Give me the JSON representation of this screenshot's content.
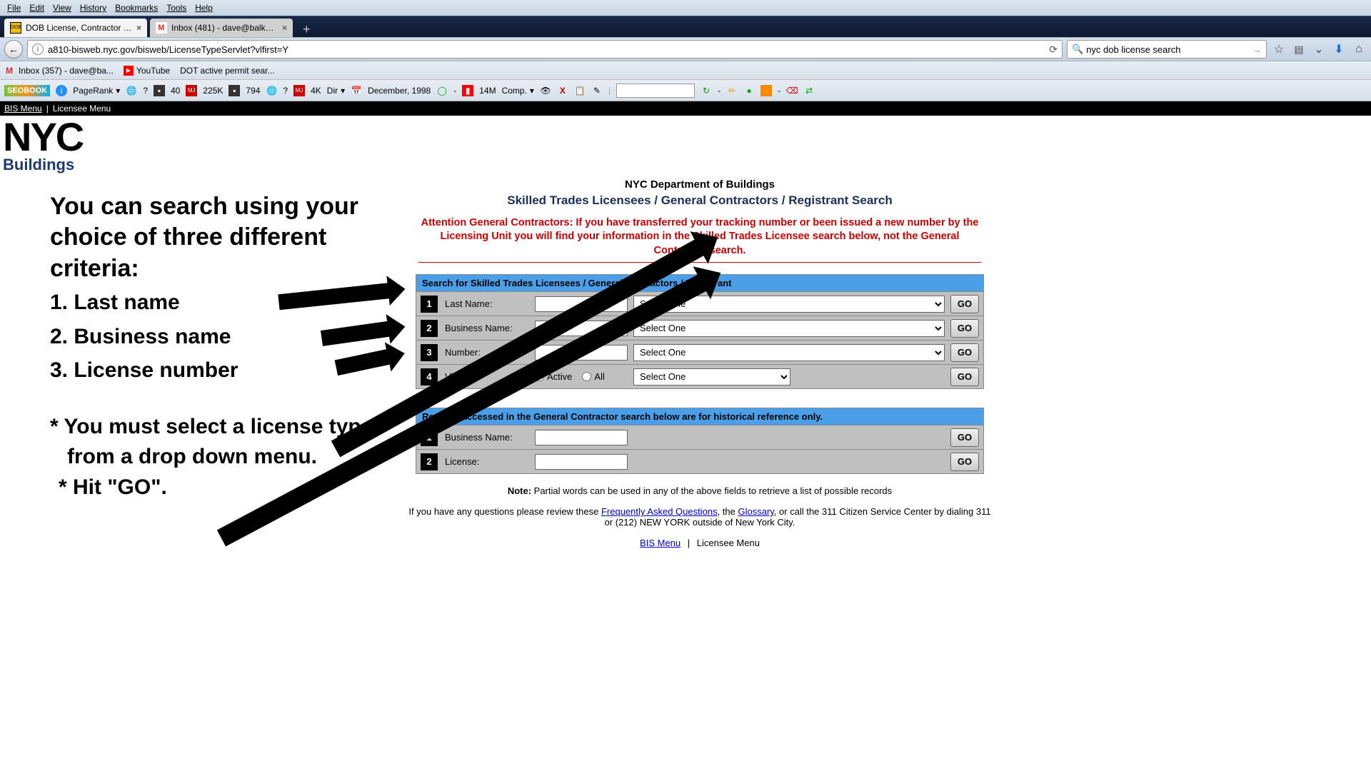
{
  "menubar": [
    "File",
    "Edit",
    "View",
    "History",
    "Bookmarks",
    "Tools",
    "Help"
  ],
  "tabs": [
    {
      "title": "DOB License, Contractor S...",
      "favicon": "dob"
    },
    {
      "title": "Inbox (481) - dave@balkan...",
      "favicon": "gmail"
    }
  ],
  "url": "a810-bisweb.nyc.gov/bisweb/LicenseTypeServlet?vlfirst=Y",
  "searchbox": "nyc dob license search",
  "bookmarks": [
    {
      "icon": "gmail",
      "label": "Inbox (357) - dave@ba..."
    },
    {
      "icon": "yt",
      "label": "YouTube"
    },
    {
      "icon": "",
      "label": "DOT active permit sear..."
    }
  ],
  "seobar": {
    "seobook": "SEOBOOK",
    "pagerank": "PageRank",
    "q1": "?",
    "v40": "40",
    "v225k": "225K",
    "v794": "794",
    "q2": "?",
    "v4k": "4K",
    "dir": "Dir",
    "date": "December, 1998",
    "v14m": "14M",
    "comp": "Comp."
  },
  "topnav": {
    "bis": "BIS Menu",
    "lic": "Licensee Menu"
  },
  "logo": {
    "nyc": "NYC",
    "sub": "Buildings"
  },
  "annot": {
    "heading": "You can search using your choice of three different criteria:",
    "c1": "1. Last name",
    "c2": "2. Business name",
    "c3": "3. License number",
    "n1": "* You must select a license type from a drop down menu.",
    "n2": "* Hit \"GO\"."
  },
  "page": {
    "dept": "NYC Department of Buildings",
    "sub": "Skilled Trades Licensees / General Contractors / Registrant Search",
    "attention": "Attention General Contractors: If you have transferred your tracking number or been issued a new number by the Licensing Unit you will find your information in the Skilled Trades Licensee search below, not the General Contractor search.",
    "block1_header": "Search for Skilled Trades Licensees / General Contractors / Registrant",
    "rows1": [
      {
        "n": "1",
        "label": "Last Name:",
        "sel": "Select One"
      },
      {
        "n": "2",
        "label": "Business Name:",
        "sel": "Select One"
      },
      {
        "n": "3",
        "label": "Number:",
        "sel": "Select One"
      }
    ],
    "row4": {
      "n": "4",
      "label": "View:",
      "radio1": "Active",
      "radio2": "All",
      "sel": "Select One"
    },
    "block2_header": "Records accessed in the General Contractor search below are for historical reference only.",
    "rows2": [
      {
        "n": "1",
        "label": "Business Name:"
      },
      {
        "n": "2",
        "label": "License:"
      }
    ],
    "go": "GO",
    "note_bold": "Note:",
    "note": " Partial words can be used in any of the above fields to retrieve a list of possible records",
    "help1": "If you have any questions please review these ",
    "faq": "Frequently Asked Questions",
    "help2": ", the ",
    "glossary": "Glossary",
    "help3": ", or call the 311 Citizen Service Center by dialing 311 or (212) NEW YORK outside of New York City.",
    "foot_bis": "BIS Menu",
    "foot_lic": "Licensee Menu"
  }
}
